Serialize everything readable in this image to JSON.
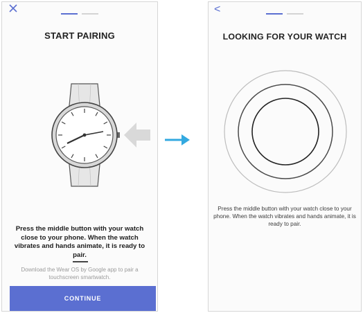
{
  "colors": {
    "accent": "#5b6fd1",
    "arrow": "#33a9e0"
  },
  "left_screen": {
    "close_icon": "close-icon",
    "title": "START PAIRING",
    "instruction": "Press the middle button with your watch close to your phone. When the watch vibrates and hands animate, it is ready to pair.",
    "hint": "Download the Wear OS by Google app to pair a touchscreen smartwatch.",
    "continue_label": "CONTINUE"
  },
  "flow_arrow_icon": "arrow-right-icon",
  "right_screen": {
    "back_label": "<",
    "title": "LOOKING FOR YOUR WATCH",
    "instruction": "Press the middle button with your watch close to your phone. When the watch vibrates and hands animate, it is ready to pair."
  }
}
